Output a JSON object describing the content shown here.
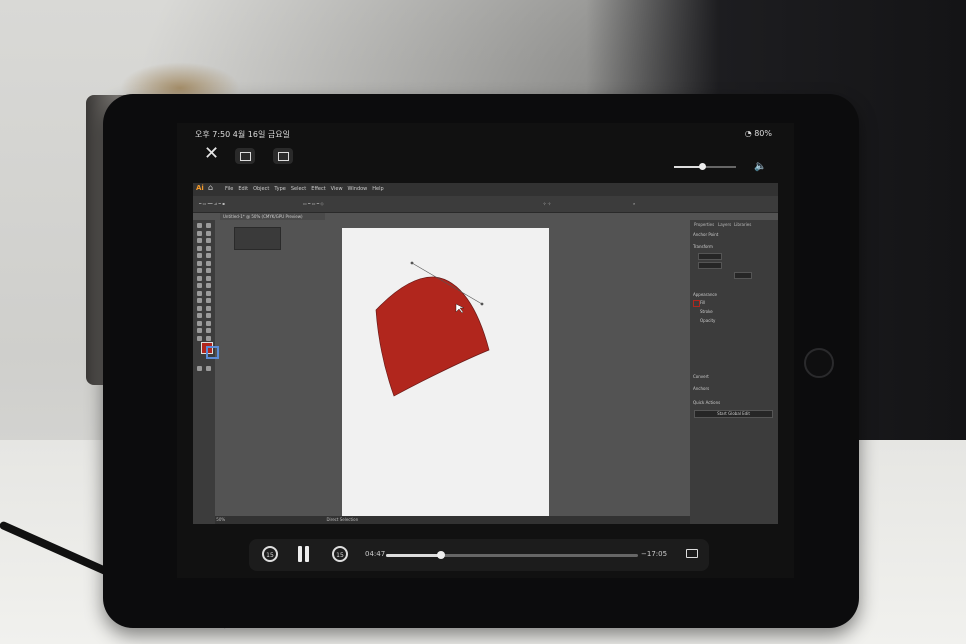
{
  "status": {
    "time": "오후 7:50   4월 16일 금요일",
    "battery": "80%"
  },
  "player": {
    "elapsed": "04:47",
    "remaining": "−17:05",
    "progress": 0.22,
    "volume": 0.45,
    "skip_back_label": "15",
    "skip_fwd_label": "15"
  },
  "illustrator": {
    "logo": "Ai",
    "menus": [
      "File",
      "Edit",
      "Object",
      "Type",
      "Select",
      "Effect",
      "View",
      "Window",
      "Help"
    ],
    "doc_tab": "Untitled-1* @ 50% (CMYK/GPU Preview)",
    "panel_tabs": [
      "Properties",
      "Layers",
      "Libraries"
    ],
    "panel_sections": [
      "Anchor Point",
      "Transform",
      "Appearance",
      "Fill",
      "Stroke",
      "Opacity",
      "Convert",
      "Anchors",
      "Quick Actions"
    ],
    "quick_action_button": "Start Global Edit",
    "status_zoom": "50%",
    "status_tool": "Direct Selection",
    "colors": {
      "shape_fill": "#b1261d",
      "artboard": "#f1f1f1",
      "canvas": "#535353"
    }
  }
}
